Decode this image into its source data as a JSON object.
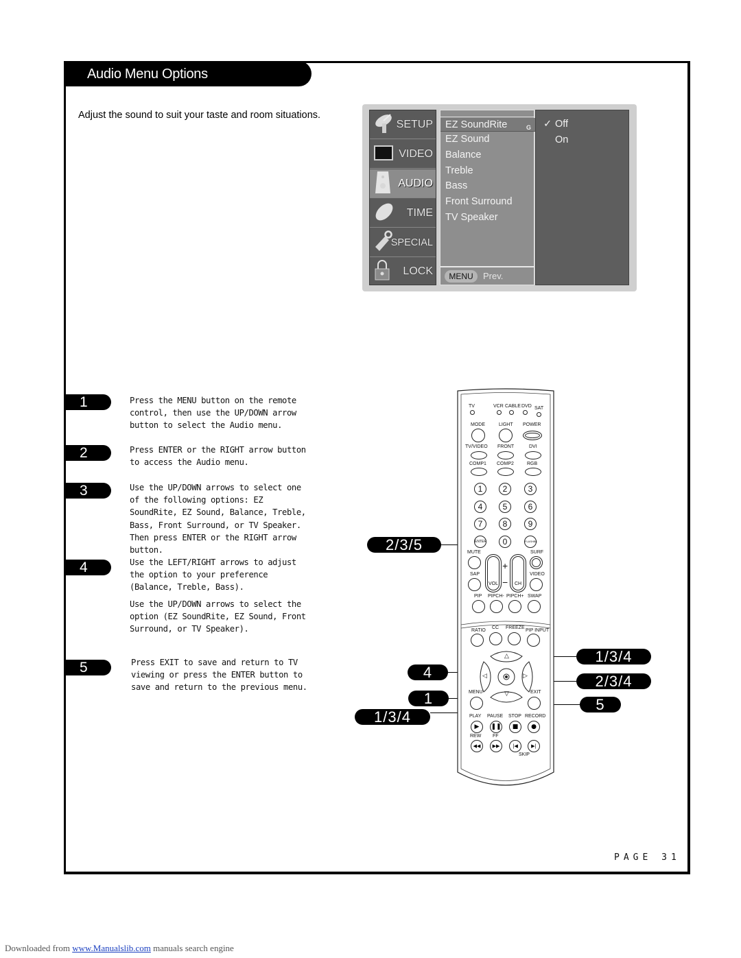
{
  "header": {
    "title": "Audio Menu Options",
    "intro": "Adjust the sound to suit your taste and room situations."
  },
  "osd": {
    "side_menu": [
      {
        "label": "SETUP",
        "icon": "satellite-dish-icon",
        "active": false
      },
      {
        "label": "VIDEO",
        "icon": "tv-screen-icon",
        "active": false
      },
      {
        "label": "AUDIO",
        "icon": "speaker-icon",
        "active": true
      },
      {
        "label": "TIME",
        "icon": "clock-disc-icon",
        "active": false
      },
      {
        "label": "SPECIAL",
        "icon": "tag-key-icon",
        "active": false
      },
      {
        "label": "LOCK",
        "icon": "padlock-icon",
        "active": false
      }
    ],
    "options": [
      "EZ SoundRite",
      "EZ Sound",
      "Balance",
      "Treble",
      "Bass",
      "Front Surround",
      "TV Speaker"
    ],
    "selected_option_marker": "G",
    "values": [
      {
        "label": "Off",
        "checked": true,
        "mark": "✓"
      },
      {
        "label": "On",
        "checked": false,
        "mark": ""
      }
    ],
    "footer": {
      "menu_button": "MENU",
      "prev_label": "Prev."
    }
  },
  "steps": [
    {
      "number": "1",
      "text": "Press the MENU button on the remote control, then use the UP/DOWN arrow button to select the Audio menu."
    },
    {
      "number": "2",
      "text": "Press ENTER or the RIGHT arrow button to access the Audio menu."
    },
    {
      "number": "3",
      "text": "Use the UP/DOWN arrows to select one of the following options: EZ SoundRite, EZ Sound, Balance, Treble, Bass, Front Surround, or TV Speaker. Then press ENTER or the RIGHT arrow button."
    },
    {
      "number": "4",
      "text": "Use the LEFT/RIGHT arrows to adjust the option to your preference (Balance, Treble, Bass).",
      "extra": "Use the UP/DOWN arrows to select the option (EZ SoundRite, EZ Sound, Front Surround, or TV Speaker)."
    },
    {
      "number": "5",
      "text": "Press EXIT to save and return to TV viewing or press the ENTER button to save and return to the previous menu."
    }
  ],
  "callouts": {
    "enter": "2/3/5",
    "up": "1/3/4",
    "right": "2/3/4",
    "left": "4",
    "menu": "1",
    "down": "1/3/4",
    "exit": "5"
  },
  "remote": {
    "modes": [
      "TV",
      "VCR",
      "CABLE",
      "DVD",
      "SAT"
    ],
    "row1": [
      "MODE",
      "LIGHT",
      "POWER"
    ],
    "row2": [
      "TV/VIDEO",
      "FRONT",
      "DVI"
    ],
    "row3": [
      "COMP1",
      "COMP2",
      "RGB"
    ],
    "digits": [
      "1",
      "2",
      "3",
      "4",
      "5",
      "6",
      "7",
      "8",
      "9"
    ],
    "enter": "ENTER",
    "zero": "0",
    "flashbk": "FLASHBK",
    "mute": "MUTE",
    "surf": "SURF",
    "sap": "SAP",
    "video": "VIDEO",
    "vol": "VOL",
    "ch": "CH",
    "plus": "+",
    "minus": "−",
    "pip_row": [
      "PIP",
      "PIPCH-",
      "PIPCH+",
      "SWAP"
    ],
    "ratio_row": [
      "RATIO",
      "CC",
      "FREEZE",
      "PIP INPUT"
    ],
    "menu": "MENU",
    "exit": "EXIT",
    "transport": [
      "PLAY",
      "PAUSE",
      "STOP",
      "RECORD"
    ],
    "rew": "REW",
    "ff": "FF",
    "skip": "SKIP",
    "arrows": {
      "up": "△",
      "down": "▽",
      "left": "◁",
      "right": "▷"
    }
  },
  "page": {
    "label": "PAGE 31"
  },
  "footer": {
    "prefix": "Downloaded from ",
    "link": "www.Manualslib.com",
    "suffix": " manuals search engine"
  }
}
